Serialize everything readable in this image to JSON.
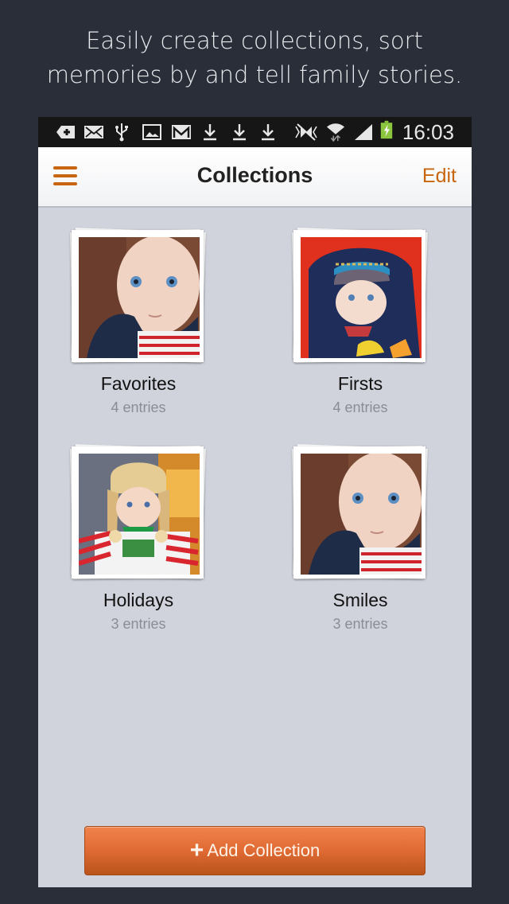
{
  "promo": {
    "line1": "Easily create collections, sort",
    "line2": "memories by and tell family stories."
  },
  "status_bar": {
    "time": "16:03",
    "icons": [
      "add-notification-icon",
      "email-icon",
      "usb-icon",
      "gallery-icon",
      "gmail-icon",
      "download-icon",
      "download-icon",
      "download-icon",
      "mute-icon",
      "wifi-icon",
      "signal-icon",
      "battery-charging-icon"
    ],
    "battery_color": "#8cc63f"
  },
  "app_bar": {
    "title": "Collections",
    "edit_label": "Edit",
    "accent": "#c8660f"
  },
  "collections": [
    {
      "name": "Favorites",
      "count": "4 entries",
      "photo": "baby-blue-eyes"
    },
    {
      "name": "Firsts",
      "count": "4 entries",
      "photo": "baby-knit-hat"
    },
    {
      "name": "Holidays",
      "count": "3 entries",
      "photo": "baby-winter-hat"
    },
    {
      "name": "Smiles",
      "count": "3 entries",
      "photo": "baby-blue-eyes"
    }
  ],
  "add_button": {
    "icon": "+",
    "label": "Add Collection",
    "color": "#e06a33"
  }
}
